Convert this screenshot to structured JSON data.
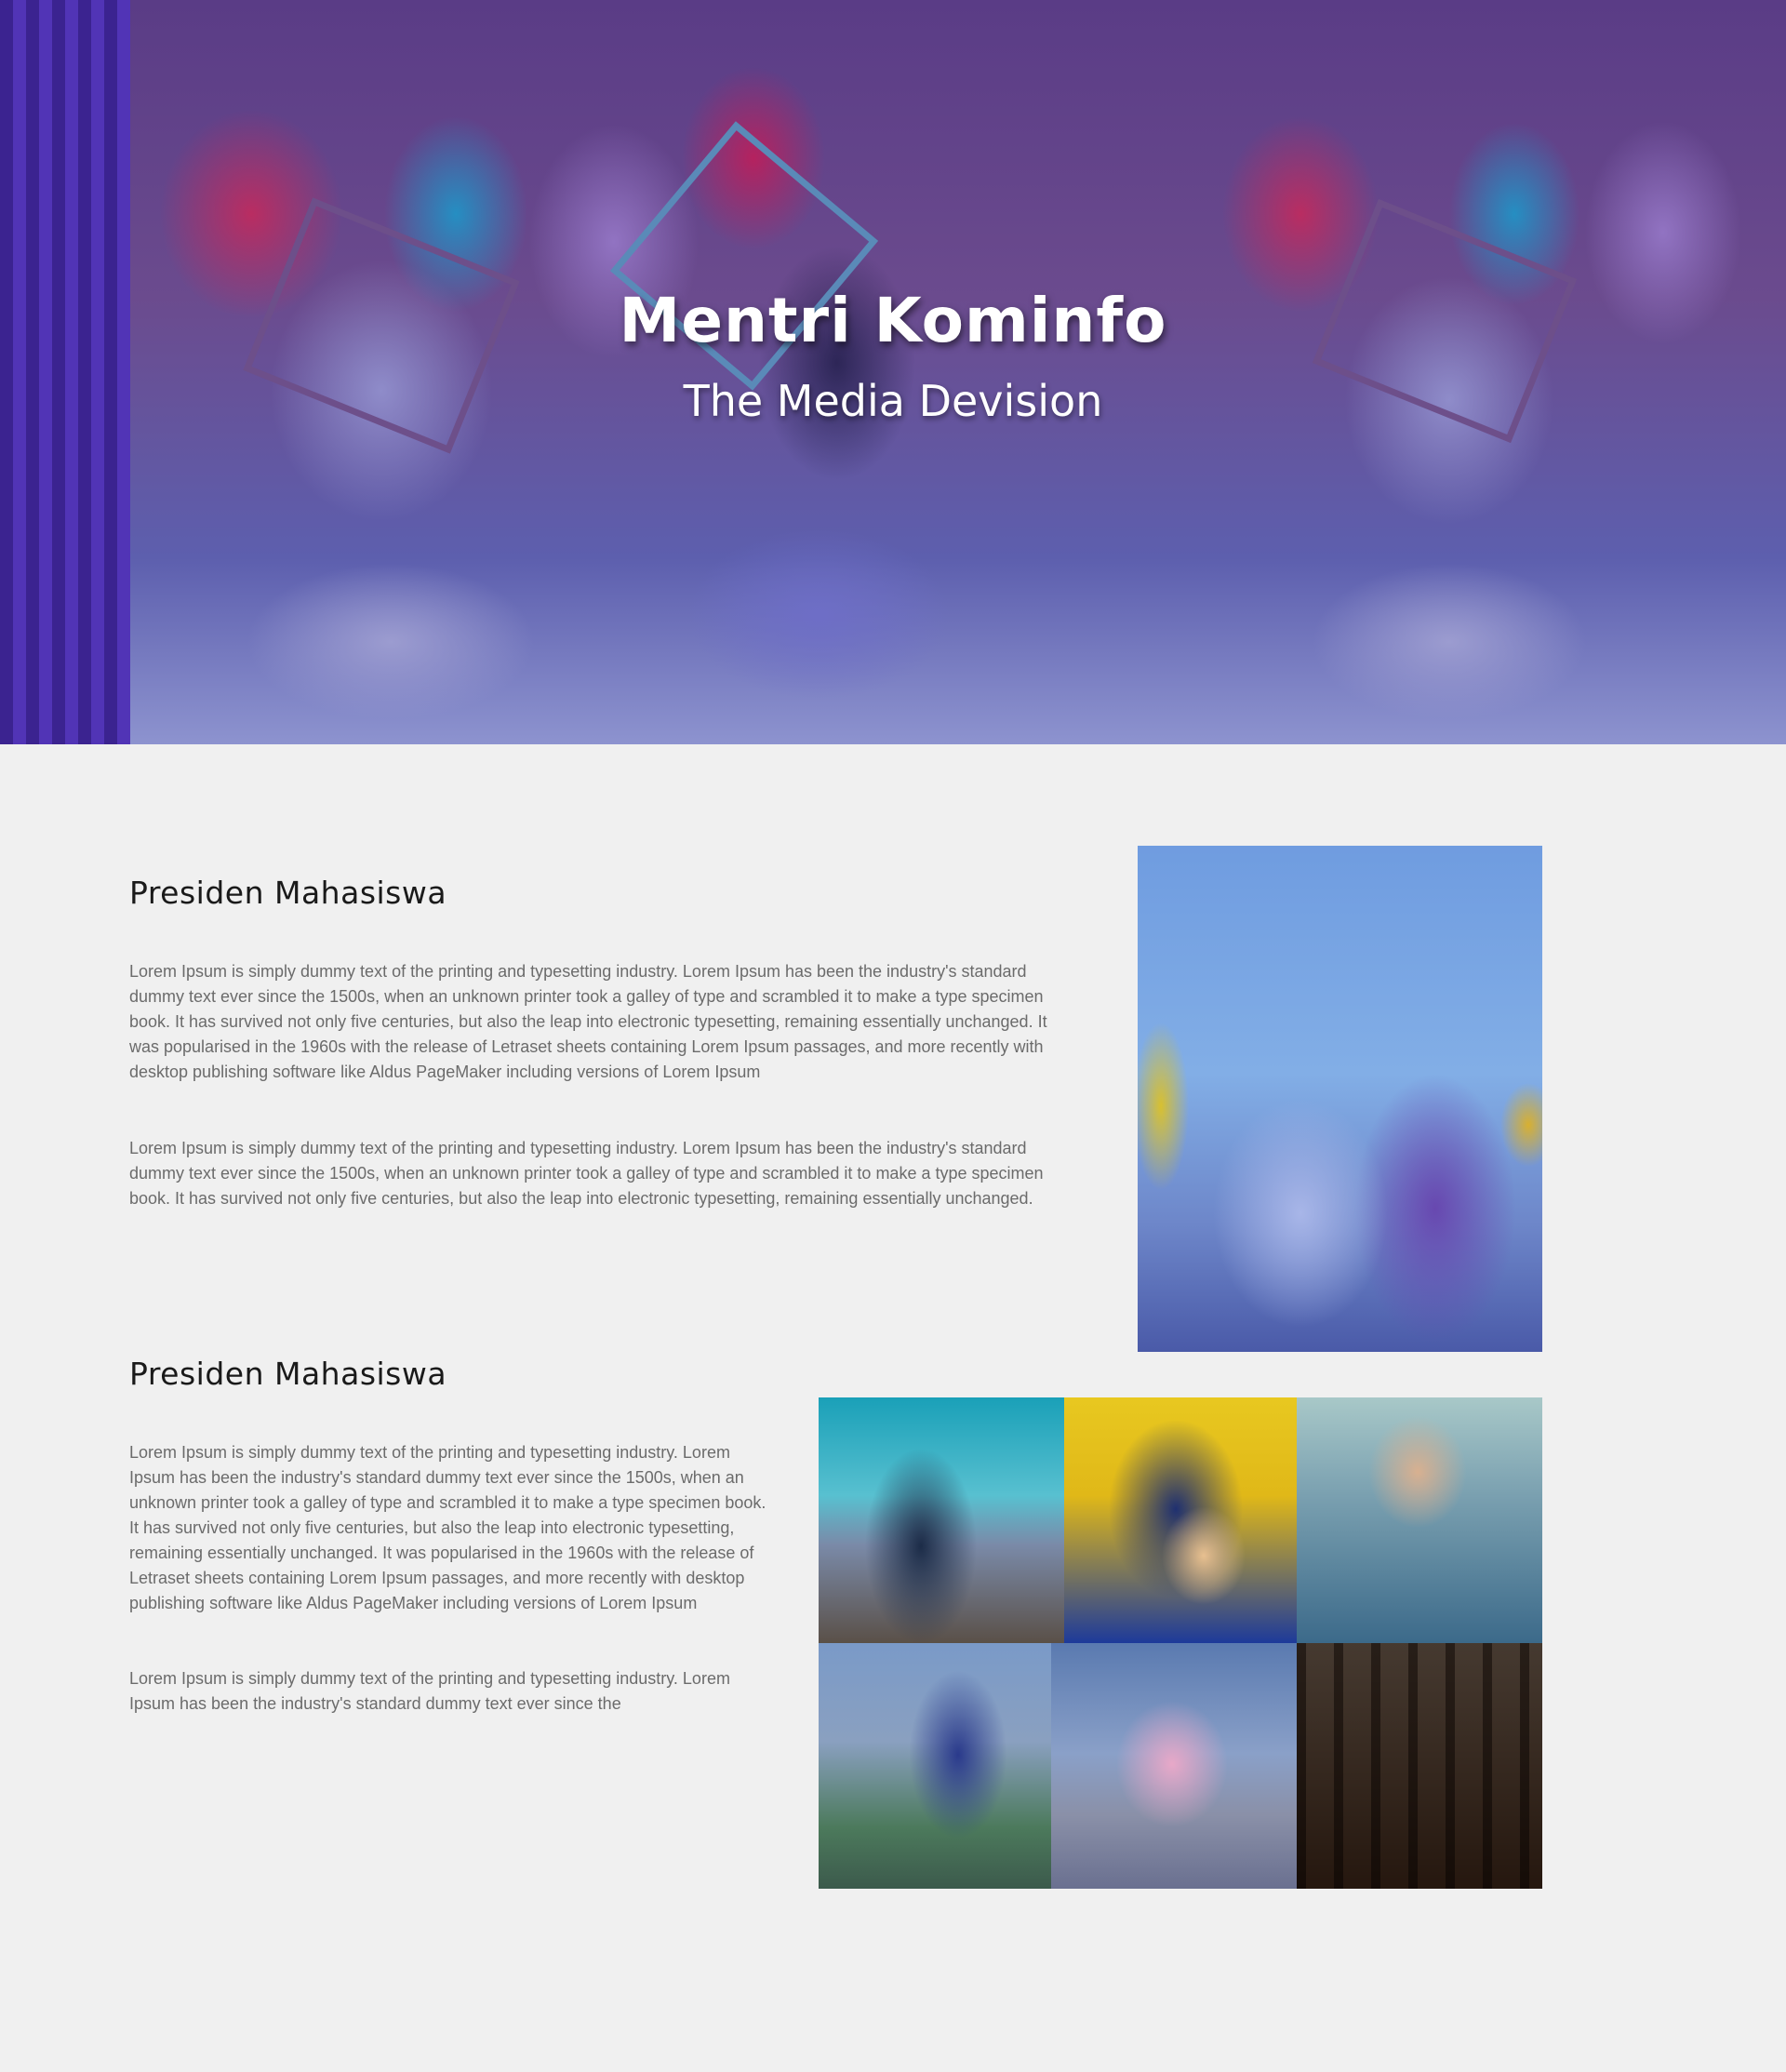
{
  "hero": {
    "title": "Mentri Kominfo",
    "subtitle": "The Media Devision"
  },
  "section1": {
    "heading": "Presiden Mahasiswa",
    "paragraph1": "Lorem Ipsum is simply dummy text of the printing and typesetting industry. Lorem Ipsum has been the industry's standard dummy text ever since the 1500s, when an unknown printer took a galley of type and scrambled it to make a type specimen book. It has survived not only five centuries, but also the leap into electronic typesetting, remaining essentially unchanged. It was popularised in the 1960s with the release of Letraset sheets containing Lorem Ipsum passages, and more recently with desktop publishing software like Aldus PageMaker including versions of Lorem Ipsum",
    "paragraph2": "Lorem Ipsum is simply dummy text of the printing and typesetting industry. Lorem Ipsum has been the industry's standard dummy text ever since the 1500s, when an unknown printer took a galley of type and scrambled it to make a type specimen book. It has survived not only five centuries, but also the leap into electronic typesetting, remaining essentially unchanged."
  },
  "section2": {
    "heading": "Presiden Mahasiswa",
    "paragraph1": "Lorem Ipsum is simply dummy text of the printing and typesetting industry. Lorem Ipsum has been the industry's standard dummy text ever since the 1500s, when an unknown printer took a galley of type and scrambled it to make a type specimen book. It has survived not only five centuries, but also the leap into electronic typesetting, remaining essentially unchanged. It was popularised in the 1960s with the release of Letraset sheets containing Lorem Ipsum passages, and more recently with desktop publishing software like Aldus PageMaker including versions of Lorem Ipsum",
    "paragraph2": "Lorem Ipsum is simply dummy text of the printing and typesetting industry. Lorem Ipsum has been the industry's standard dummy text ever since the"
  }
}
